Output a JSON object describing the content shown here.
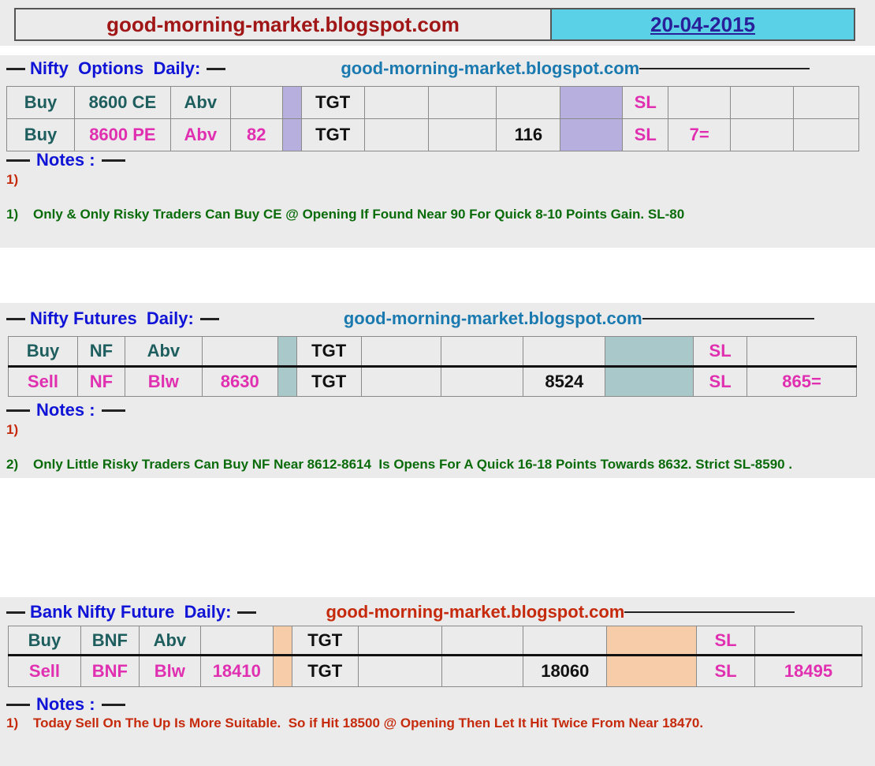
{
  "header": {
    "site": "good-morning-market.blogspot.com",
    "date": "20-04-2015"
  },
  "sections": [
    {
      "id": "nifty-options",
      "title": "Nifty  Options  Daily:",
      "blog": "good-morning-market.blogspot.com",
      "colors": {
        "accent": "#b7b0de",
        "blog": "#1a7ab0"
      },
      "rows": [
        [
          "Buy",
          "8600 CE",
          "Abv",
          "",
          "",
          "TGT",
          "",
          "",
          "",
          "",
          "SL",
          "",
          "",
          ""
        ],
        [
          "Buy",
          "8600 PE",
          "Abv",
          "82",
          "",
          "TGT",
          "",
          "",
          "116",
          "",
          "SL",
          "7=",
          "",
          ""
        ]
      ],
      "notes_label": "Notes :",
      "notes": [
        "1)",
        "1)    Only & Only Risky Traders Can Buy CE @ Opening If Found Near 90 For Quick 8-10 Points Gain. SL-80"
      ]
    },
    {
      "id": "nifty-futures",
      "title": "Nifty Futures  Daily:",
      "blog": "good-morning-market.blogspot.com",
      "colors": {
        "accent": "#a9c8c9",
        "blog": "#1a7ab0"
      },
      "rows": [
        [
          "Buy",
          "NF",
          "Abv",
          "",
          "",
          "TGT",
          "",
          "",
          "",
          "",
          "SL",
          ""
        ],
        [
          "Sell",
          "NF",
          "Blw",
          "8630",
          "",
          "TGT",
          "",
          "",
          "8524",
          "",
          "SL",
          "865="
        ]
      ],
      "notes_label": "Notes :",
      "notes": [
        "1)",
        "2)    Only Little Risky Traders Can Buy NF Near 8612-8614  Is Opens For A Quick 16-18 Points Towards 8632. Strict SL-8590 ."
      ]
    },
    {
      "id": "bank-nifty",
      "title": "Bank Nifty Future  Daily:",
      "blog": "good-morning-market.blogspot.com",
      "colors": {
        "accent": "#f6cda8",
        "blog": "#c62a0c"
      },
      "rows": [
        [
          "Buy",
          "BNF",
          "Abv",
          "",
          "",
          "TGT",
          "",
          "",
          "",
          "",
          "SL",
          ""
        ],
        [
          "Sell",
          "BNF",
          "Blw",
          "18410",
          "",
          "TGT",
          "",
          "",
          "18060",
          "",
          "SL",
          "18495"
        ]
      ],
      "notes_label": "Notes :",
      "notes": [
        "1)    Today Sell On The Up Is More Suitable.  So if Hit 18500 @ Opening Then Let It Hit Twice From Near 18470."
      ]
    }
  ]
}
